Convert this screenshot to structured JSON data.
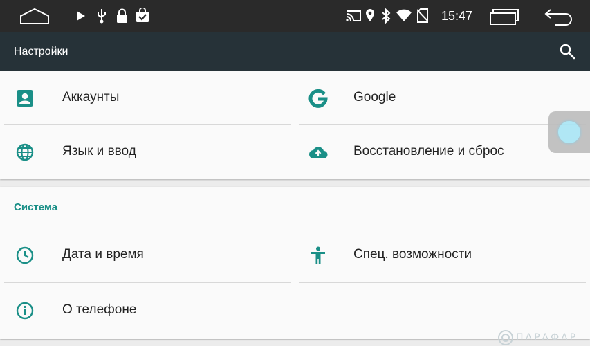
{
  "status_bar": {
    "time": "15:47",
    "left_icons": [
      "home-nav-icon",
      "play-icon",
      "usb-icon",
      "lock-icon",
      "bag-check-icon"
    ],
    "right_icons": [
      "cast-icon",
      "location-icon",
      "bluetooth-icon",
      "wifi-icon",
      "no-sim-icon",
      "recents-nav-icon",
      "back-nav-icon"
    ]
  },
  "toolbar": {
    "title": "Настройки",
    "search_icon": "search-icon"
  },
  "personal_section": {
    "items": [
      {
        "label": "Аккаунты",
        "icon": "account-icon"
      },
      {
        "label": "Google",
        "icon": "google-icon"
      },
      {
        "label": "Язык и ввод",
        "icon": "globe-icon"
      },
      {
        "label": "Восстановление и сброс",
        "icon": "cloud-upload-icon"
      }
    ]
  },
  "system_section": {
    "title": "Система",
    "items": [
      {
        "label": "Дата и время",
        "icon": "clock-icon"
      },
      {
        "label": "Спец. возможности",
        "icon": "accessibility-icon"
      },
      {
        "label": "О телефоне",
        "icon": "info-icon"
      }
    ]
  },
  "watermark": {
    "text": "ПАРАФАР"
  },
  "colors": {
    "status_bar_bg": "#2a2a2a",
    "toolbar_bg": "#263238",
    "accent": "#1a8f87",
    "card_bg": "#fafafa",
    "page_bg": "#ececec"
  }
}
